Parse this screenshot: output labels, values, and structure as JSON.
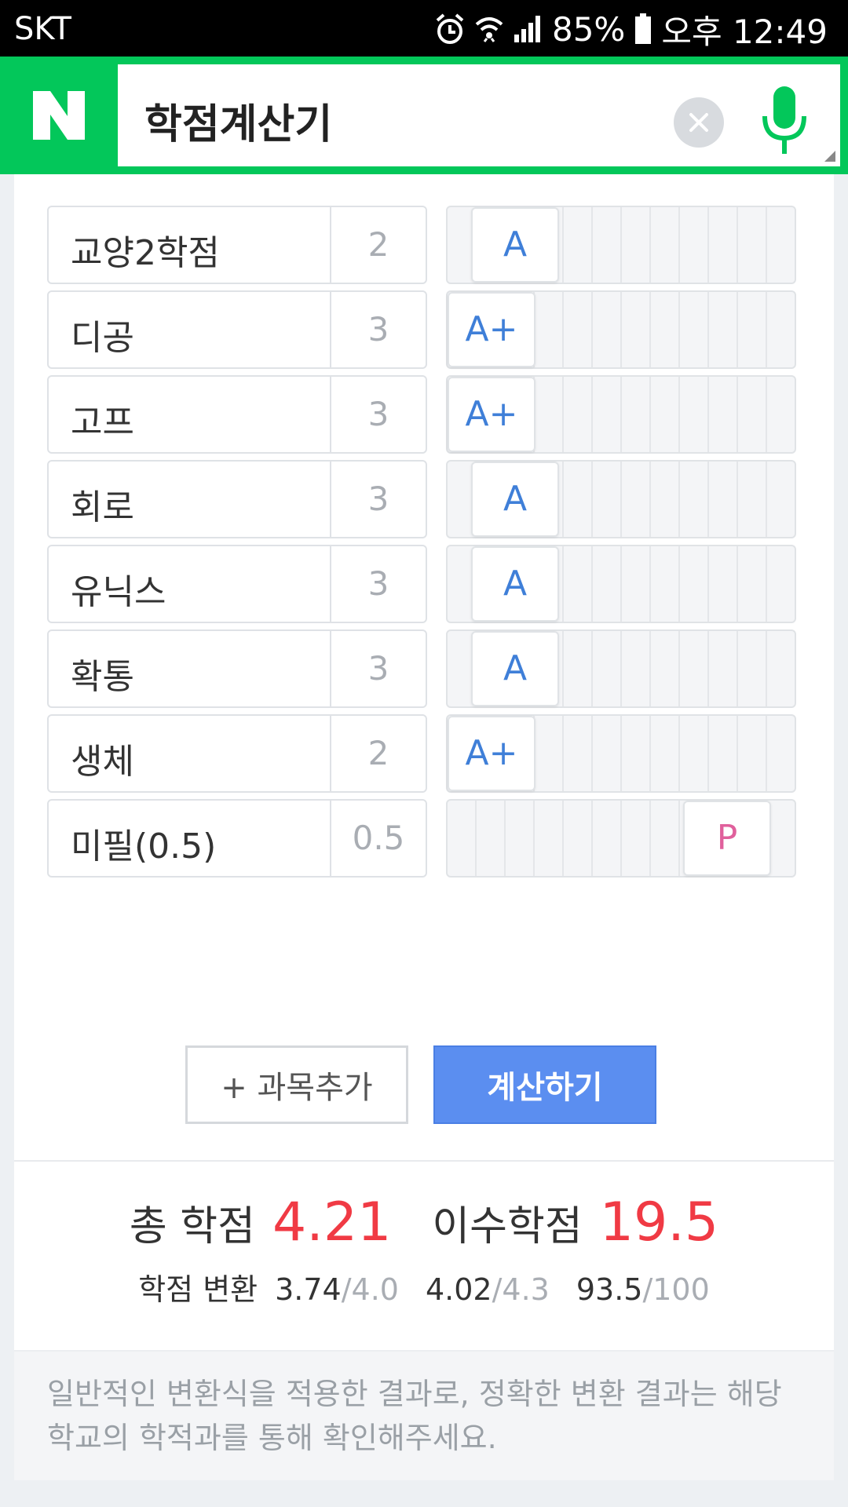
{
  "status_bar": {
    "carrier": "SKT",
    "battery": "85%",
    "time": "오후 12:49",
    "icons": [
      "alarm-icon",
      "wifi-icon",
      "signal-icon",
      "battery-icon"
    ]
  },
  "search": {
    "logo": "N",
    "query": "학점계산기",
    "clear_icon": "clear-icon",
    "voice_icon": "microphone-icon"
  },
  "subjects": [
    {
      "name": "교양2학점",
      "credit": "2",
      "grade": "A",
      "grade_index": 1
    },
    {
      "name": "디공",
      "credit": "3",
      "grade": "A+",
      "grade_index": 0
    },
    {
      "name": "고프",
      "credit": "3",
      "grade": "A+",
      "grade_index": 0
    },
    {
      "name": "회로",
      "credit": "3",
      "grade": "A",
      "grade_index": 1
    },
    {
      "name": "유닉스",
      "credit": "3",
      "grade": "A",
      "grade_index": 1
    },
    {
      "name": "확통",
      "credit": "3",
      "grade": "A",
      "grade_index": 1
    },
    {
      "name": "생체",
      "credit": "2",
      "grade": "A+",
      "grade_index": 0
    },
    {
      "name": "미필(0.5)",
      "credit": "0.5",
      "grade": "P",
      "grade_index": 10
    }
  ],
  "buttons": {
    "add_label": "+ 과목추가",
    "calc_label": "계산하기"
  },
  "result": {
    "total_label": "총 학점",
    "total_value": "4.21",
    "credits_label": "이수학점",
    "credits_value": "19.5",
    "convert_label": "학점 변환",
    "conversions": [
      {
        "value": "3.74",
        "scale": "/4.0"
      },
      {
        "value": "4.02",
        "scale": "/4.3"
      },
      {
        "value": "93.5",
        "scale": "/100"
      }
    ]
  },
  "notice": "일반적인 변환식을 적용한 결과로, 정확한 변환 결과는 해당 학교의 학적과를 통해 확인해주세요.",
  "colors": {
    "brand_green": "#03c75a",
    "accent_blue": "#5b8ef0",
    "grade_blue": "#3f7fd8",
    "result_red": "#f03a44",
    "pass_pink": "#e0609c"
  }
}
